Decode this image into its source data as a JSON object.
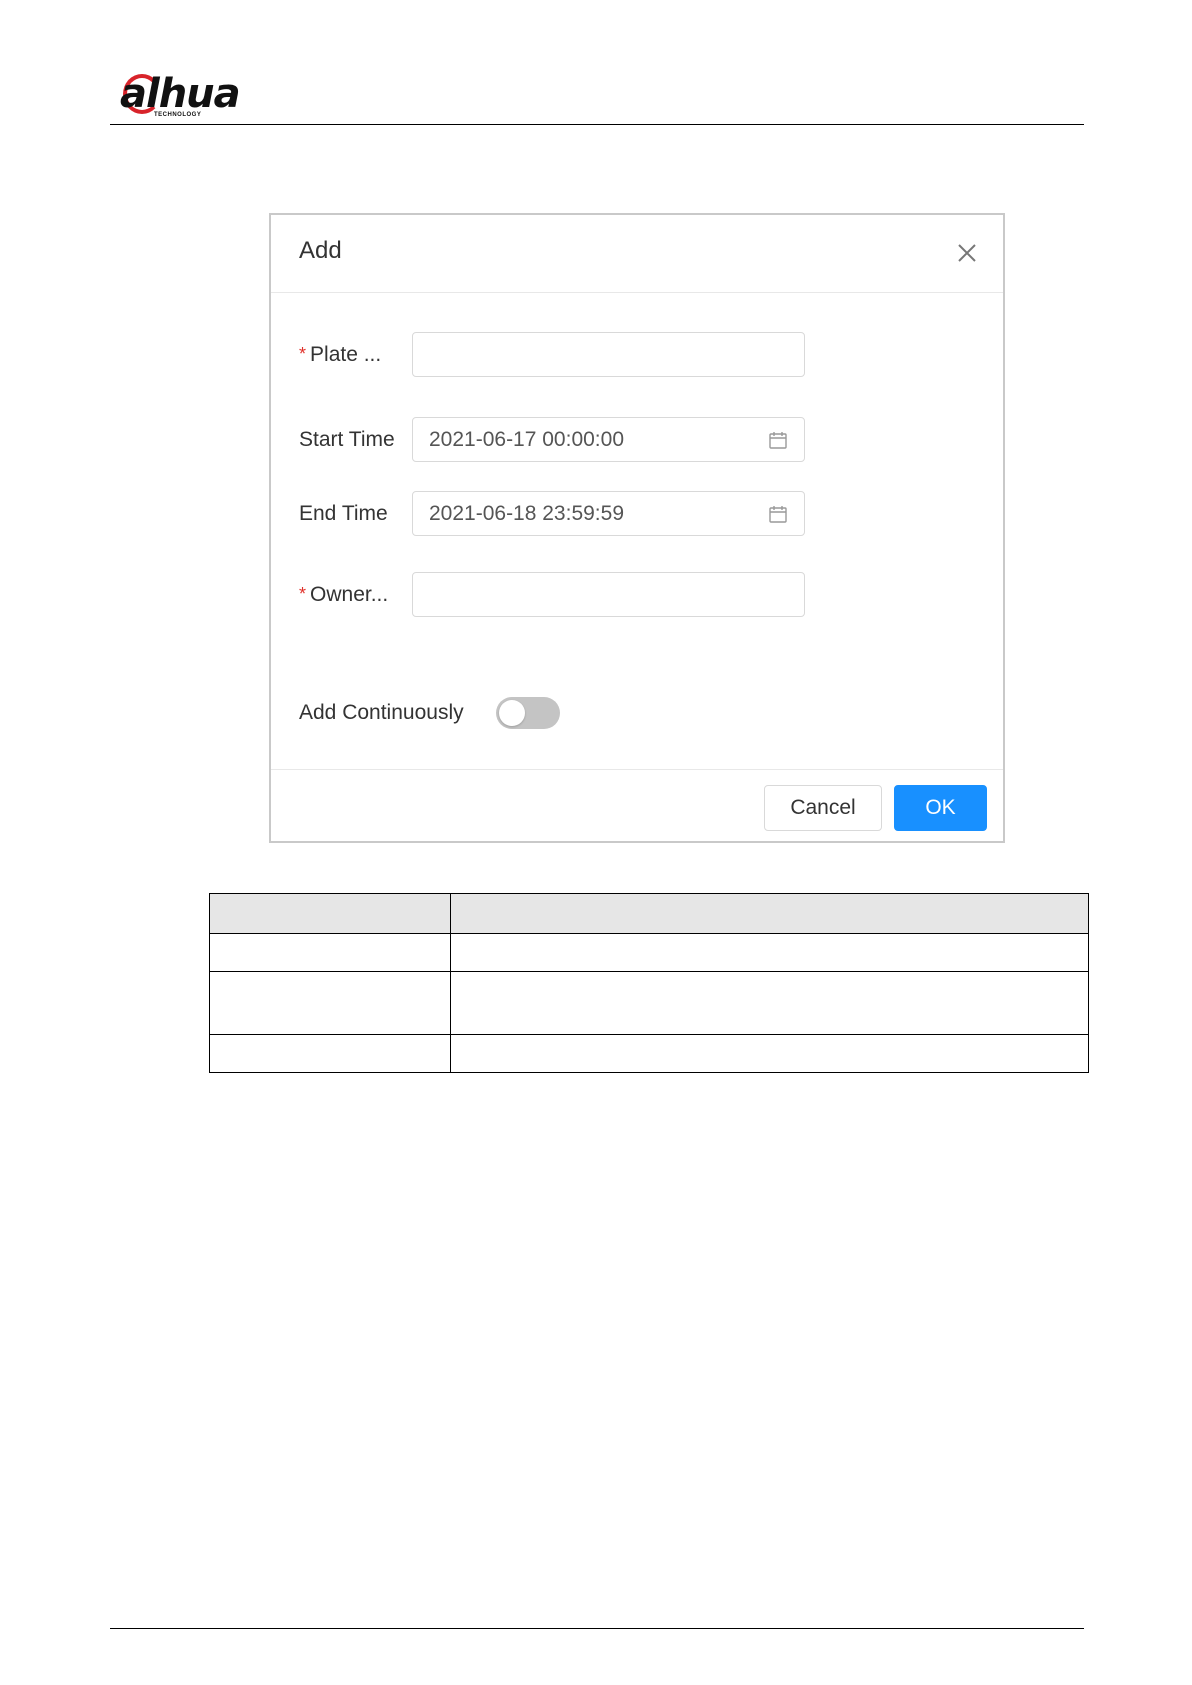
{
  "brand": {
    "logo_name": "dahua-logo",
    "logo_text": "alhua",
    "logo_subtext": "TECHNOLOGY",
    "accent_color": "#d8232a"
  },
  "dialog": {
    "title": "Add",
    "fields": [
      {
        "label": "Plate ...",
        "required": true,
        "value": ""
      },
      {
        "label": "Start Time",
        "required": false,
        "value": "2021-06-17 00:00:00"
      },
      {
        "label": "End Time",
        "required": false,
        "value": "2021-06-18 23:59:59"
      },
      {
        "label": "Owner...",
        "required": true,
        "value": ""
      }
    ],
    "required_mark": "*",
    "add_continuously": {
      "label": "Add Continuously",
      "enabled": false
    },
    "buttons": {
      "cancel": "Cancel",
      "ok": "OK"
    },
    "colors": {
      "primary": "#1890ff",
      "required": "#e0312a",
      "toggle_off": "#c4c4c4"
    }
  },
  "table": {
    "rows": [
      [
        "",
        ""
      ],
      [
        "",
        ""
      ],
      [
        "",
        ""
      ],
      [
        "",
        ""
      ]
    ]
  }
}
